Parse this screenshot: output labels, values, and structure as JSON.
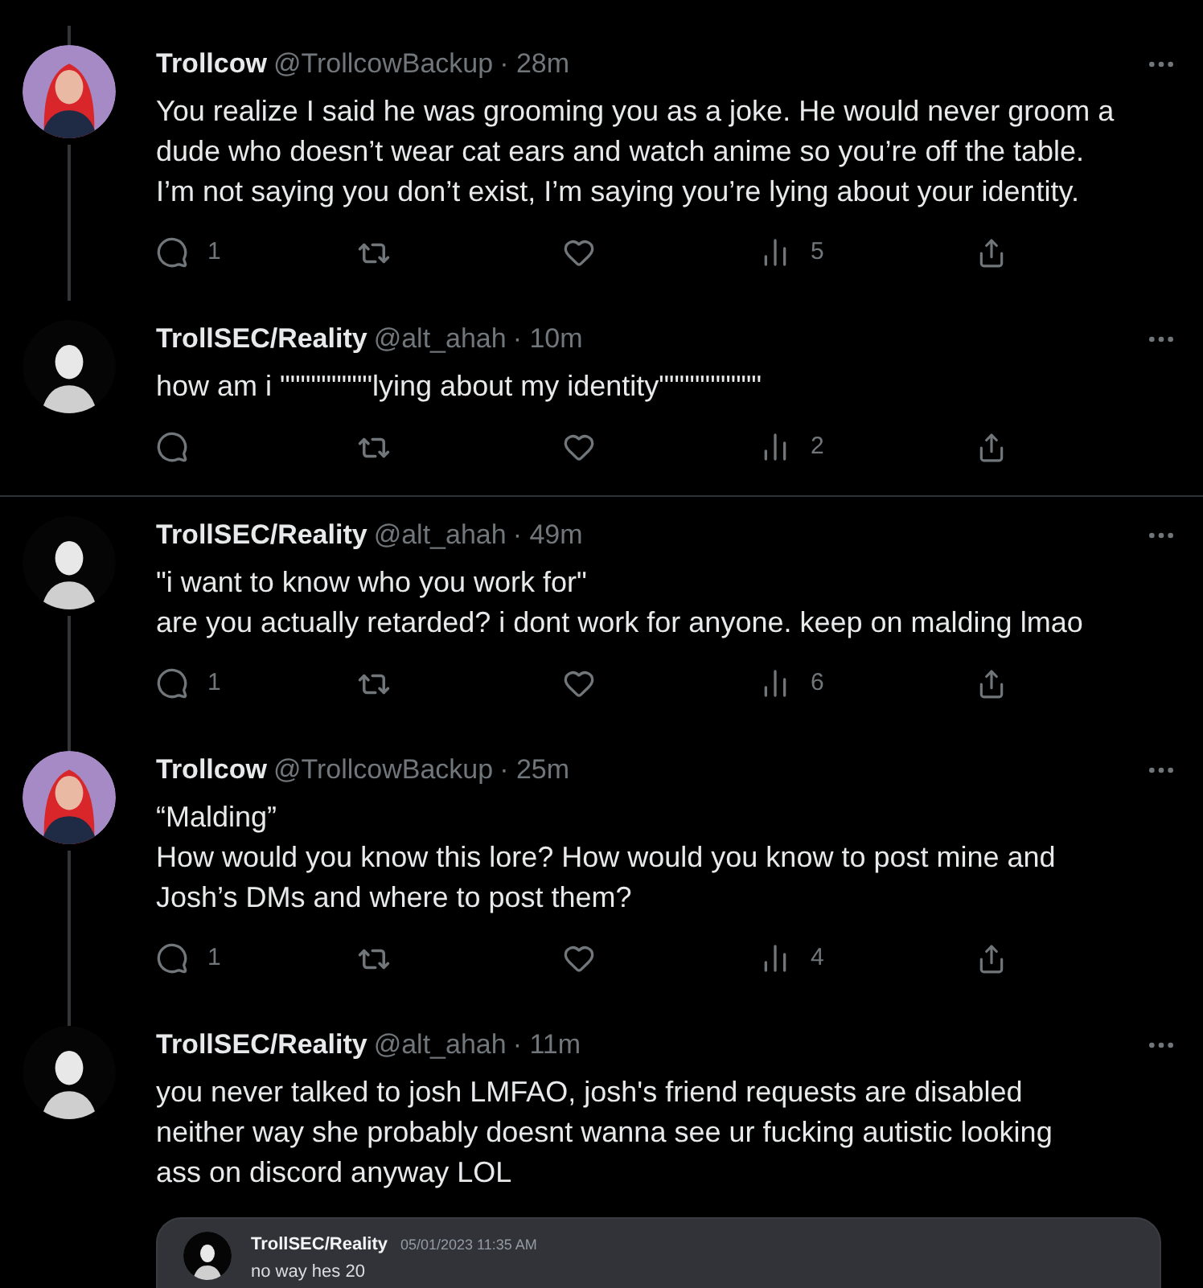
{
  "threads": [
    [
      {
        "name": "Trollcow",
        "handle": "@TrollcowBackup",
        "time": "· 28m",
        "avatar": {
          "kind": "red"
        },
        "thread_above": true,
        "thread_below": true,
        "lines": [
          "You realize I said he was grooming you as a joke. He would never groom a",
          "dude who doesn’t wear cat ears and watch anime so you’re off the table.",
          "I’m not saying you don’t exist, I’m saying you’re lying about your identity."
        ],
        "replies": "1",
        "views": "5"
      },
      {
        "name": "TrollSEC/Reality",
        "handle": "@alt_ahah",
        "time": "· 10m",
        "avatar": {
          "kind": "dark"
        },
        "thread_above": false,
        "thread_below": false,
        "lines": [
          "how am i \"\"\"\"\"\"\"\"\"lying about my identity\"\"\"\"\"\"\"\"\"\""
        ],
        "views": "2"
      }
    ],
    [
      {
        "name": "TrollSEC/Reality",
        "handle": "@alt_ahah",
        "time": "· 49m",
        "avatar": {
          "kind": "dark"
        },
        "thread_above": false,
        "thread_below": true,
        "lines": [
          "\"i want to know who you work for\"",
          "are you actually retarded? i dont work for anyone. keep on malding lmao"
        ],
        "replies": "1",
        "views": "6"
      },
      {
        "name": "Trollcow",
        "handle": "@TrollcowBackup",
        "time": "· 25m",
        "avatar": {
          "kind": "red"
        },
        "thread_above": true,
        "thread_below": true,
        "lines": [
          "“Malding”",
          "How would you know this lore? How would you know to post mine and",
          "Josh’s DMs and where to post them?"
        ],
        "replies": "1",
        "views": "4"
      },
      {
        "name": "TrollSEC/Reality",
        "handle": "@alt_ahah",
        "time": "· 11m",
        "avatar": {
          "kind": "dark"
        },
        "thread_above": true,
        "thread_below": false,
        "lines": [
          "you never talked to josh LMFAO, josh's friend requests are disabled",
          "neither way she probably doesnt wanna see ur fucking autistic looking",
          "ass on discord anyway LOL"
        ],
        "embed": {
          "name": "TrollSEC/Reality",
          "time": "05/01/2023 11:35 AM",
          "message": "no way hes 20"
        }
      }
    ]
  ]
}
